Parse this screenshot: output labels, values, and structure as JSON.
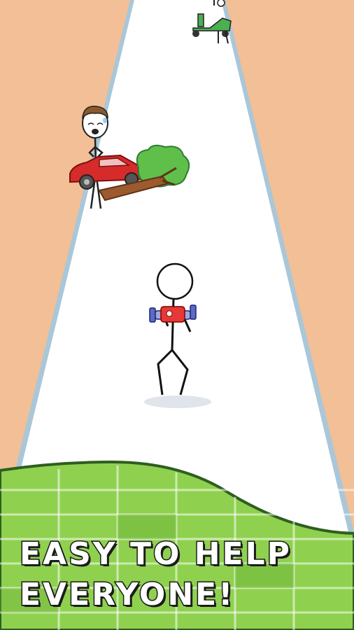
{
  "caption": {
    "line1": "EASY TO HELP",
    "line2": "EVERYONE!"
  },
  "colors": {
    "background": "#f2bf96",
    "road": "#ffffff",
    "road_edge": "#a9c7d9",
    "grass": "#8fd14f",
    "grass_dark": "#6eb33a",
    "car": "#d62b2b",
    "scooter": "#4caf50",
    "gun_body": "#e53935",
    "gun_barrel": "#5c6bc0"
  },
  "icons": {
    "player": "stickman-player-icon",
    "weapon": "toy-gun-icon",
    "npc": "crying-stickman-icon",
    "obstacle": "fallen-tree-on-car-icon",
    "vehicle": "scooter-icon"
  }
}
